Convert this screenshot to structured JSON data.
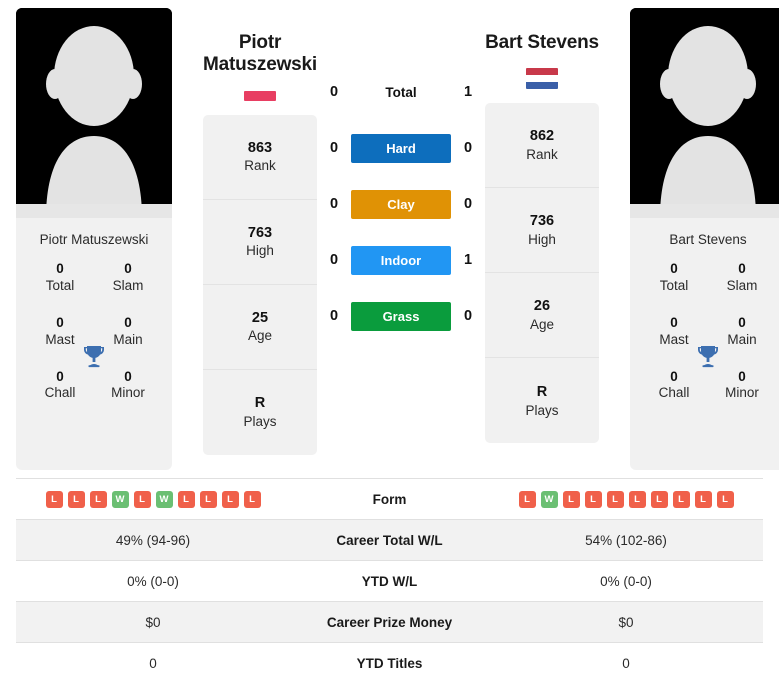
{
  "players": {
    "left": {
      "name": "Piotr Matuszewski",
      "name_line1": "Piotr",
      "name_line2": "Matuszewski",
      "photo_caption": "Piotr Matuszewski",
      "flag": "poland-flag",
      "flag_colors": [
        "#ffffff",
        "#e83e62"
      ],
      "stats": [
        {
          "value": "863",
          "label": "Rank"
        },
        {
          "value": "763",
          "label": "High"
        },
        {
          "value": "25",
          "label": "Age"
        },
        {
          "value": "R",
          "label": "Plays"
        }
      ],
      "titles": [
        {
          "value": "0",
          "label": "Total"
        },
        {
          "value": "0",
          "label": "Slam"
        },
        {
          "value": "0",
          "label": "Mast"
        },
        {
          "value": "0",
          "label": "Main"
        },
        {
          "value": "0",
          "label": "Chall"
        },
        {
          "value": "0",
          "label": "Minor"
        }
      ],
      "form": [
        "L",
        "L",
        "L",
        "W",
        "L",
        "W",
        "L",
        "L",
        "L",
        "L"
      ],
      "career_total_wl": "49% (94-96)",
      "ytd_wl": "0% (0-0)",
      "career_prize_money": "$0",
      "ytd_titles": "0"
    },
    "right": {
      "name": "Bart Stevens",
      "name_line1": "Bart Stevens",
      "name_line2": "",
      "photo_caption": "Bart Stevens",
      "flag": "netherlands-flag",
      "flag_colors": [
        "#c8394a",
        "#ffffff",
        "#3a5fa8"
      ],
      "stats": [
        {
          "value": "862",
          "label": "Rank"
        },
        {
          "value": "736",
          "label": "High"
        },
        {
          "value": "26",
          "label": "Age"
        },
        {
          "value": "R",
          "label": "Plays"
        }
      ],
      "titles": [
        {
          "value": "0",
          "label": "Total"
        },
        {
          "value": "0",
          "label": "Slam"
        },
        {
          "value": "0",
          "label": "Mast"
        },
        {
          "value": "0",
          "label": "Main"
        },
        {
          "value": "0",
          "label": "Chall"
        },
        {
          "value": "0",
          "label": "Minor"
        }
      ],
      "form": [
        "L",
        "W",
        "L",
        "L",
        "L",
        "L",
        "L",
        "L",
        "L",
        "L"
      ],
      "career_total_wl": "54% (102-86)",
      "ytd_wl": "0% (0-0)",
      "career_prize_money": "$0",
      "ytd_titles": "0"
    }
  },
  "head_to_head": [
    {
      "label": "Total",
      "left": "0",
      "right": "1",
      "color": ""
    },
    {
      "label": "Hard",
      "left": "0",
      "right": "0",
      "color": "#0d6ebd"
    },
    {
      "label": "Clay",
      "left": "0",
      "right": "0",
      "color": "#e09205"
    },
    {
      "label": "Indoor",
      "left": "0",
      "right": "1",
      "color": "#2196f3"
    },
    {
      "label": "Grass",
      "left": "0",
      "right": "0",
      "color": "#0a9c3d"
    }
  ],
  "table": {
    "rows": [
      {
        "label": "Form",
        "type": "form",
        "left": "",
        "right": ""
      },
      {
        "label": "Career Total W/L",
        "type": "text",
        "left": "49% (94-96)",
        "right": "54% (102-86)"
      },
      {
        "label": "YTD W/L",
        "type": "text",
        "left": "0% (0-0)",
        "right": "0% (0-0)"
      },
      {
        "label": "Career Prize Money",
        "type": "text",
        "left": "$0",
        "right": "$0"
      },
      {
        "label": "YTD Titles",
        "type": "text",
        "left": "0",
        "right": "0"
      }
    ]
  },
  "colors": {
    "win_badge": "#6bbf73",
    "loss_badge": "#f0604a",
    "trophy": "#3d6fb0",
    "panel_bg": "#f1f1f1"
  },
  "icons": {
    "trophy": "trophy-icon",
    "avatar": "avatar-placeholder-icon"
  }
}
